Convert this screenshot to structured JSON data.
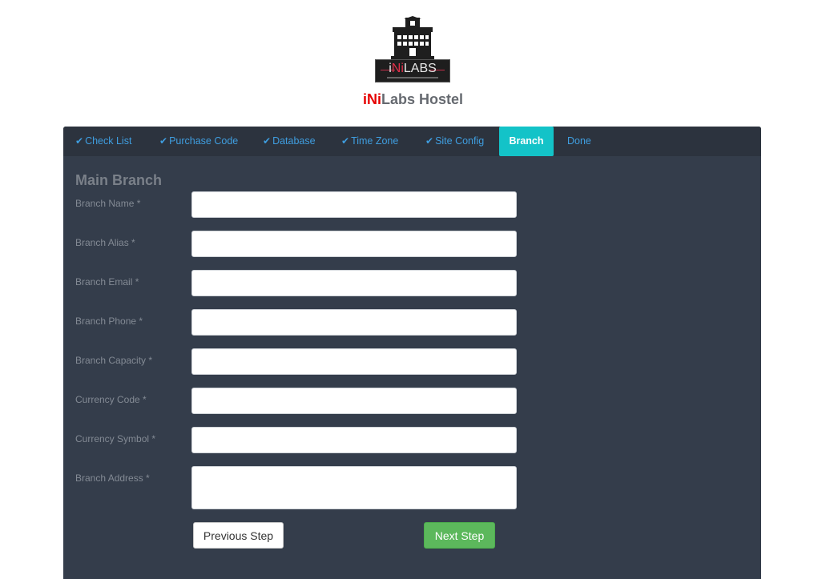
{
  "header": {
    "logo_prefix": "i",
    "logo_mid": "Ni",
    "logo_suffix": "LABS",
    "brand_red": "iNi",
    "brand_rest": "Labs Hostel"
  },
  "tabs": [
    {
      "label": "Check List",
      "done": true
    },
    {
      "label": "Purchase Code",
      "done": true
    },
    {
      "label": "Database",
      "done": true
    },
    {
      "label": "Time Zone",
      "done": true
    },
    {
      "label": "Site Config",
      "done": true
    },
    {
      "label": "Branch",
      "done": false,
      "active": true
    },
    {
      "label": "Done",
      "done": false
    }
  ],
  "form": {
    "title": "Main Branch",
    "fields": [
      {
        "label": "Branch Name *",
        "value": ""
      },
      {
        "label": "Branch Alias *",
        "value": ""
      },
      {
        "label": "Branch Email *",
        "value": ""
      },
      {
        "label": "Branch Phone *",
        "value": ""
      },
      {
        "label": "Branch Capacity *",
        "value": ""
      },
      {
        "label": "Currency Code *",
        "value": ""
      },
      {
        "label": "Currency Symbol *",
        "value": ""
      },
      {
        "label": "Branch Address *",
        "value": ""
      }
    ],
    "prev_label": "Previous Step",
    "next_label": "Next Step"
  },
  "colors": {
    "panel_bg": "#343d4b",
    "tab_bar_bg": "#2c333e",
    "tab_link": "#3f9ee0",
    "tab_active": "#13c3c8",
    "next_button": "#5cb85c",
    "brand_red": "#e60000"
  },
  "icons": {
    "tab_check": "check-icon",
    "logo": "hostel-building-icon"
  }
}
